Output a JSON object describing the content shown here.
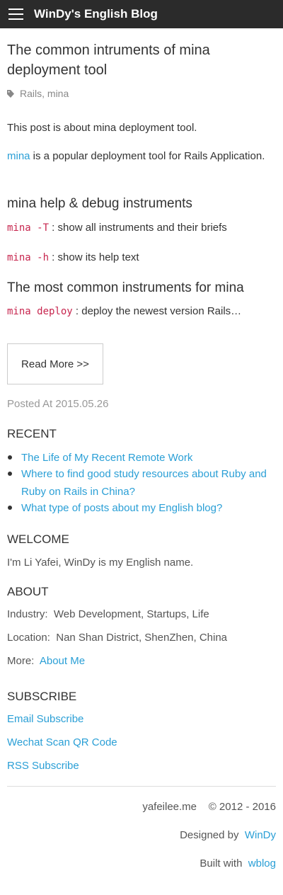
{
  "navbar": {
    "brand": "WinDy's English Blog"
  },
  "post": {
    "title": "The common intruments of mina deployment tool",
    "tags": [
      "Rails",
      "mina"
    ],
    "tag_separator": ", ",
    "intro": "This post is about mina deployment tool.",
    "para2_link": "mina",
    "para2_text": " is a popular deployment tool for Rails Application.",
    "heading1": "mina help & debug instruments",
    "cmd1": "mina -T",
    "cmd1_desc": " : show all instruments and their briefs",
    "cmd2": "mina -h",
    "cmd2_desc": " : show its help text",
    "heading2": "The most common instruments for mina",
    "cmd3": "mina deploy",
    "cmd3_desc": " : deploy the newest version Rails…",
    "read_more_label": "Read More >>",
    "posted_at": "Posted At 2015.05.26"
  },
  "sidebar": {
    "recent_title": "RECENT",
    "recent_items": [
      "The Life of My Recent Remote Work",
      "Where to find good study resources about Ruby and Ruby on Rails in China?",
      "What type of posts about my English blog?"
    ],
    "welcome_title": "WELCOME",
    "welcome_text": "I'm Li Yafei, WinDy is my English name.",
    "about_title": "ABOUT",
    "industry_label": "Industry:",
    "industry_value": "Web Development, Startups, Life",
    "location_label": "Location:",
    "location_value": "Nan Shan District, ShenZhen, China",
    "more_label": "More:",
    "more_link": "About Me",
    "subscribe_title": "SUBSCRIBE",
    "subscribe_links": [
      "Email Subscribe",
      "Wechat Scan QR Code",
      "RSS Subscribe"
    ]
  },
  "footer": {
    "site": "yafeilee.me",
    "copyright": "© 2012 - 2016",
    "designed_label": "Designed by",
    "designed_link": "WinDy",
    "built_label": "Built with",
    "built_link": "wblog"
  },
  "colors": {
    "navbar_bg": "#2b2b2b",
    "link": "#2a9fd6",
    "code": "#c7254e",
    "muted": "#999999"
  },
  "icons": {
    "menu": "hamburger-icon",
    "tag": "tag-icon"
  }
}
